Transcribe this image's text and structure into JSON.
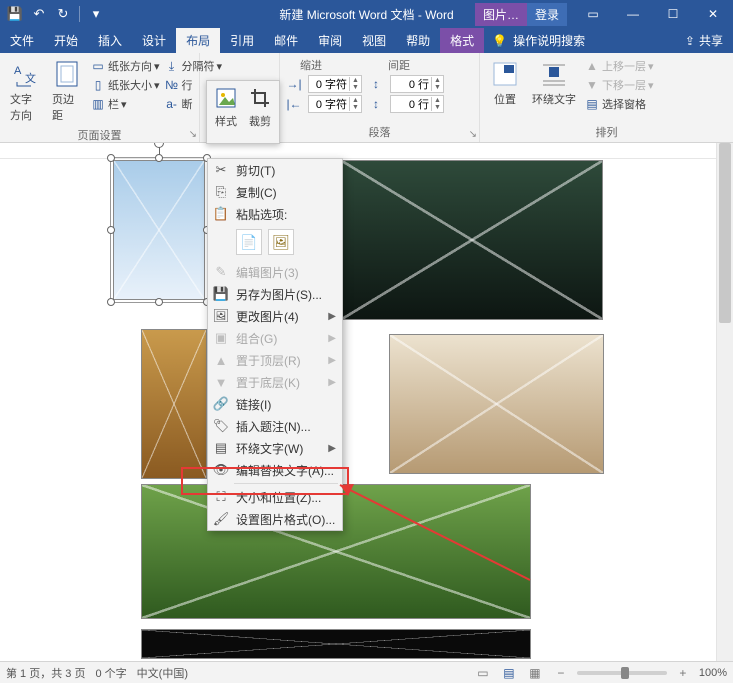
{
  "title": "新建 Microsoft Word 文档 - Word",
  "contextual_tab_label": "图片…",
  "login_label": "登录",
  "tabs": {
    "file": "文件",
    "home": "开始",
    "insert": "插入",
    "design": "设计",
    "layout": "布局",
    "references": "引用",
    "mailings": "邮件",
    "review": "审阅",
    "view": "视图",
    "help": "帮助",
    "format": "格式",
    "tell_me": "操作说明搜索"
  },
  "share": "共享",
  "ribbon": {
    "page_setup": {
      "label": "页面设置",
      "text_direction": "文字方向",
      "margins": "页边距",
      "orientation": "纸张方向",
      "size": "纸张大小",
      "columns": "栏",
      "breaks": "分隔符",
      "line_numbers": "行",
      "hyphenation": "断"
    },
    "paragraph": {
      "label": "段落",
      "indent_label": "缩进",
      "spacing_label": "间距",
      "indent_left": "0 字符",
      "indent_right": "0 字符",
      "space_before": "0 行",
      "space_after": "0 行"
    },
    "arrange": {
      "label": "排列",
      "position": "位置",
      "wrap_text": "环绕文字",
      "bring_forward": "上移一层",
      "send_backward": "下移一层",
      "selection_pane": "选择窗格"
    }
  },
  "mini": {
    "styles": "样式",
    "crop": "裁剪"
  },
  "context_menu": {
    "cut": "剪切(T)",
    "copy": "复制(C)",
    "paste_options_label": "粘贴选项:",
    "edit_picture": "编辑图片(3)",
    "save_as_picture": "另存为图片(S)...",
    "change_picture": "更改图片(4)",
    "group": "组合(G)",
    "bring_to_front": "置于顶层(R)",
    "send_to_back": "置于底层(K)",
    "link": "链接(I)",
    "insert_caption": "插入题注(N)...",
    "wrap_text": "环绕文字(W)",
    "edit_alt_text": "编辑替换文字(A)...",
    "size_and_position": "大小和位置(Z)...",
    "format_picture": "设置图片格式(O)..."
  },
  "status": {
    "page": "第 1 页，共 3 页",
    "words": "0 个字",
    "language": "中文(中国)",
    "zoom": "100%"
  }
}
